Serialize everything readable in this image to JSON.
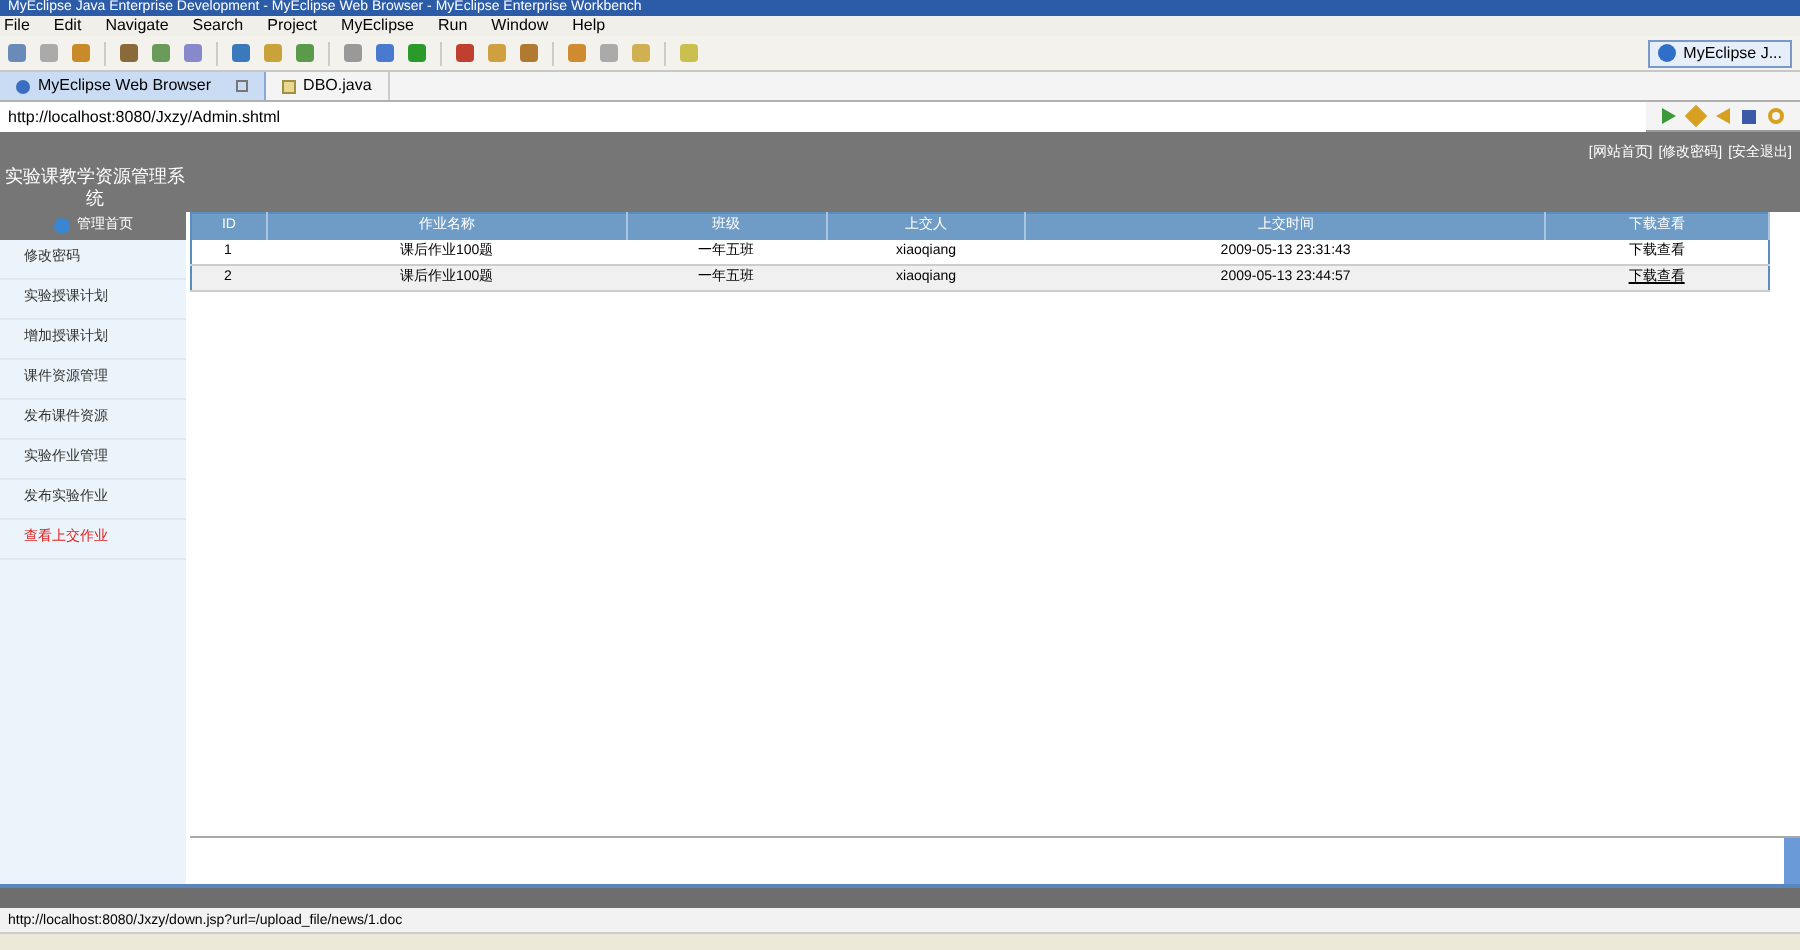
{
  "window": {
    "title": "MyEclipse Java Enterprise Development - MyEclipse Web Browser - MyEclipse Enterprise Workbench"
  },
  "menu": [
    "File",
    "Edit",
    "Navigate",
    "Search",
    "Project",
    "MyEclipse",
    "Run",
    "Window",
    "Help"
  ],
  "perspective": {
    "label": "MyEclipse J..."
  },
  "editor_tabs": [
    {
      "label": "MyEclipse Web Browser",
      "selected": true
    },
    {
      "label": "DBO.java",
      "selected": false
    }
  ],
  "address": {
    "value": "http://localhost:8080/Jxzy/Admin.shtml"
  },
  "page": {
    "site_title": "实验课教学资源管理系统",
    "top_links": [
      "[网站首页]",
      "[修改密码]",
      "[安全退出]"
    ],
    "sidebar": {
      "header": "管理首页",
      "items": [
        {
          "label": "修改密码",
          "selected": false
        },
        {
          "label": "实验授课计划",
          "selected": false
        },
        {
          "label": "增加授课计划",
          "selected": false
        },
        {
          "label": "课件资源管理",
          "selected": false
        },
        {
          "label": "发布课件资源",
          "selected": false
        },
        {
          "label": "实验作业管理",
          "selected": false
        },
        {
          "label": "发布实验作业",
          "selected": false
        },
        {
          "label": "查看上交作业",
          "selected": true
        }
      ]
    },
    "table": {
      "columns": [
        "ID",
        "作业名称",
        "班级",
        "上交人",
        "上交时间",
        "下载查看"
      ],
      "rows": [
        [
          "1",
          "课后作业100题",
          "一年五班",
          "xiaoqiang",
          "2009-05-13 23:31:43",
          "下载查看"
        ],
        [
          "2",
          "课后作业100题",
          "一年五班",
          "xiaoqiang",
          "2009-05-13 23:44:57",
          "下载查看"
        ]
      ]
    }
  },
  "status_bar": {
    "text": "http://localhost:8080/Jxzy/down.jsp?url=/upload_file/news/1.doc"
  }
}
